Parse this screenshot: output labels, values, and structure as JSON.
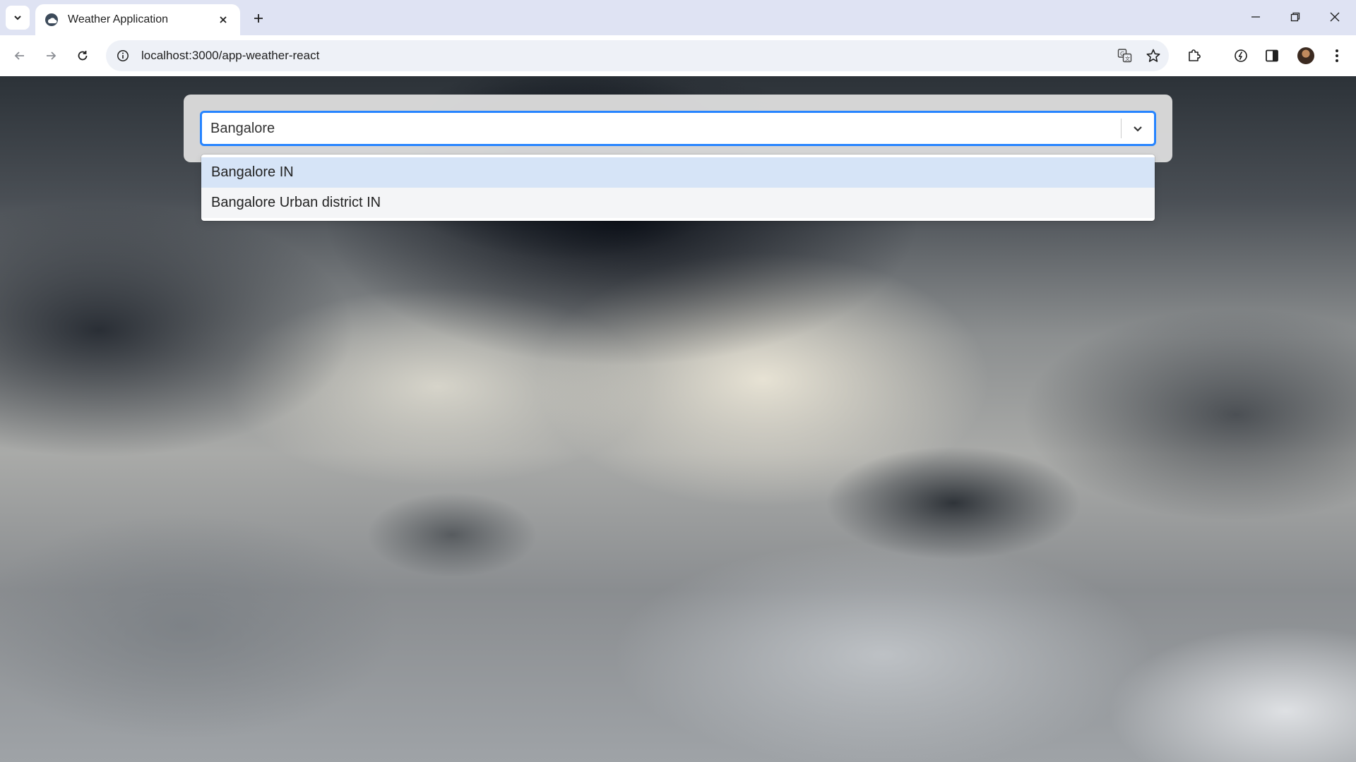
{
  "browser": {
    "tab_title": "Weather Application",
    "url": "localhost:3000/app-weather-react"
  },
  "icons": {
    "tab_search": "chevron-down-icon",
    "favicon": "cloud-icon",
    "tab_close": "close-icon",
    "new_tab": "plus-icon",
    "minimize": "minimize-icon",
    "restore": "restore-icon",
    "close_window": "close-icon",
    "back": "arrow-left-icon",
    "forward": "arrow-right-icon",
    "reload": "reload-icon",
    "site_info": "info-icon",
    "translate": "translate-icon",
    "bookmark": "star-icon",
    "extensions": "puzzle-icon",
    "performance": "speed-icon",
    "side_panel": "side-panel-icon",
    "menu": "more-vertical-icon"
  },
  "search": {
    "value": "Bangalore",
    "dropdown_options": [
      {
        "label": "Bangalore IN"
      },
      {
        "label": "Bangalore Urban district IN"
      }
    ]
  },
  "colors": {
    "focus_border": "#2684ff",
    "option_focused": "#d6e4f7"
  }
}
